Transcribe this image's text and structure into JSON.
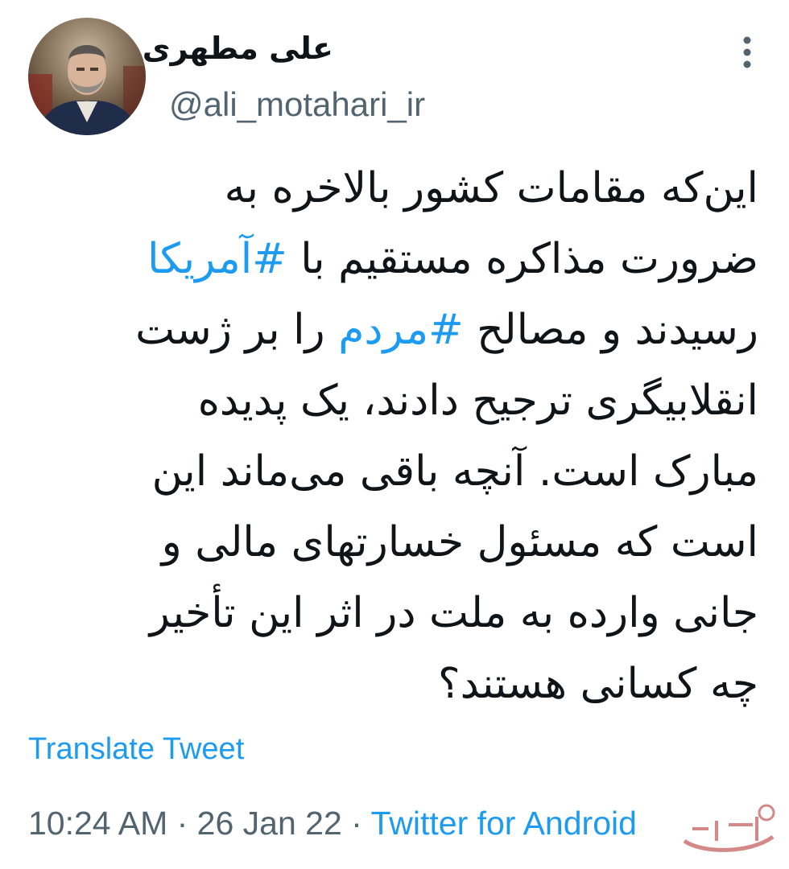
{
  "author": {
    "display_name": "علی مطهری",
    "handle": "@ali_motahari_ir",
    "avatar_icon": "profile-photo"
  },
  "more_icon": "more-vertical-icon",
  "tweet": {
    "lines": [
      [
        {
          "text": "این‌که مقامات کشور بالاخره به"
        }
      ],
      [
        {
          "text": "ضرورت مذاکره مستقیم با "
        },
        {
          "text": "#آمریکا",
          "hashtag": true
        }
      ],
      [
        {
          "text": "رسیدند و مصالح "
        },
        {
          "text": "#مردم",
          "hashtag": true
        },
        {
          "text": " را بر ژست"
        }
      ],
      [
        {
          "text": "انقلابیگری ترجیح دادند، یک پدیده"
        }
      ],
      [
        {
          "text": "مبارک است. آنچه باقی می‌ماند این"
        }
      ],
      [
        {
          "text": "است که مسئول خسارتهای مالی و"
        }
      ],
      [
        {
          "text": "جانی وارده به ملت در اثر این تأخیر"
        }
      ],
      [
        {
          "text": "چه کسانی هستند؟"
        }
      ]
    ]
  },
  "translate_label": "Translate Tweet",
  "meta": {
    "time": "10:24 AM",
    "separator": " · ",
    "date": "26 Jan 22",
    "source": "Twitter for Android"
  },
  "colors": {
    "link": "#1d9bf0",
    "secondary_text": "#536471",
    "primary_text": "#0f1419"
  },
  "watermark_icon": "site-logo-watermark"
}
